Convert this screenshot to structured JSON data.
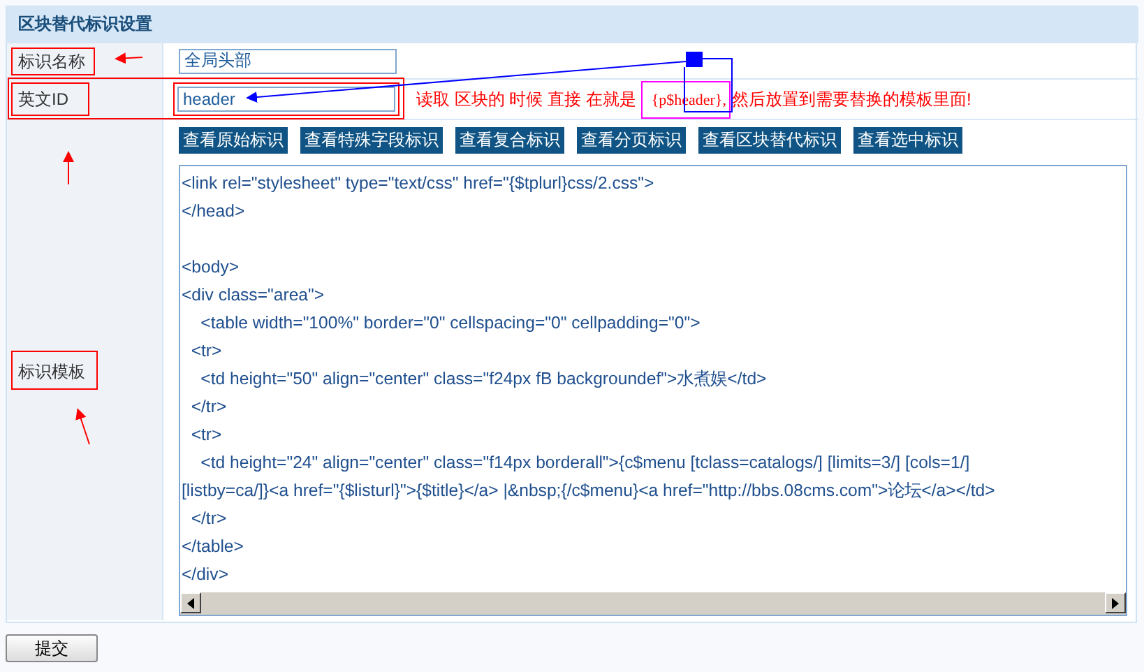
{
  "title": "区块替代标识设置",
  "name_field": {
    "label": "标识名称",
    "value": "全局头部"
  },
  "id_field": {
    "label": "英文ID",
    "value": "header",
    "hint_before": "读取 区块的 时候 直接 在就是",
    "hint_code": "{p$header},",
    "hint_after": "然后放置到需要替换的模板里面!"
  },
  "template": {
    "label": "标识模板",
    "buttons": [
      "查看原始标识",
      "查看特殊字段标识",
      "查看复合标识",
      "查看分页标识",
      "查看区块替代标识",
      "查看选中标识"
    ],
    "code": "<link rel=\"stylesheet\" type=\"text/css\" href=\"{$tplurl}css/2.css\">\n</head>\n\n<body>\n<div class=\"area\">\n    <table width=\"100%\" border=\"0\" cellspacing=\"0\" cellpadding=\"0\">\n  <tr>\n    <td height=\"50\" align=\"center\" class=\"f24px fB backgroundef\">水煮娱</td>\n  </tr>\n  <tr>\n    <td height=\"24\" align=\"center\" class=\"f14px borderall\">{c$menu [tclass=catalogs/] [limits=3/] [cols=1/]\n[listby=ca/]}<a href=\"{$listurl}\">{$title}</a> |&nbsp;{/c$menu}<a href=\"http://bbs.08cms.com\">论坛</a></td>\n  </tr>\n</table>\n</div>"
  },
  "submit": "提交"
}
